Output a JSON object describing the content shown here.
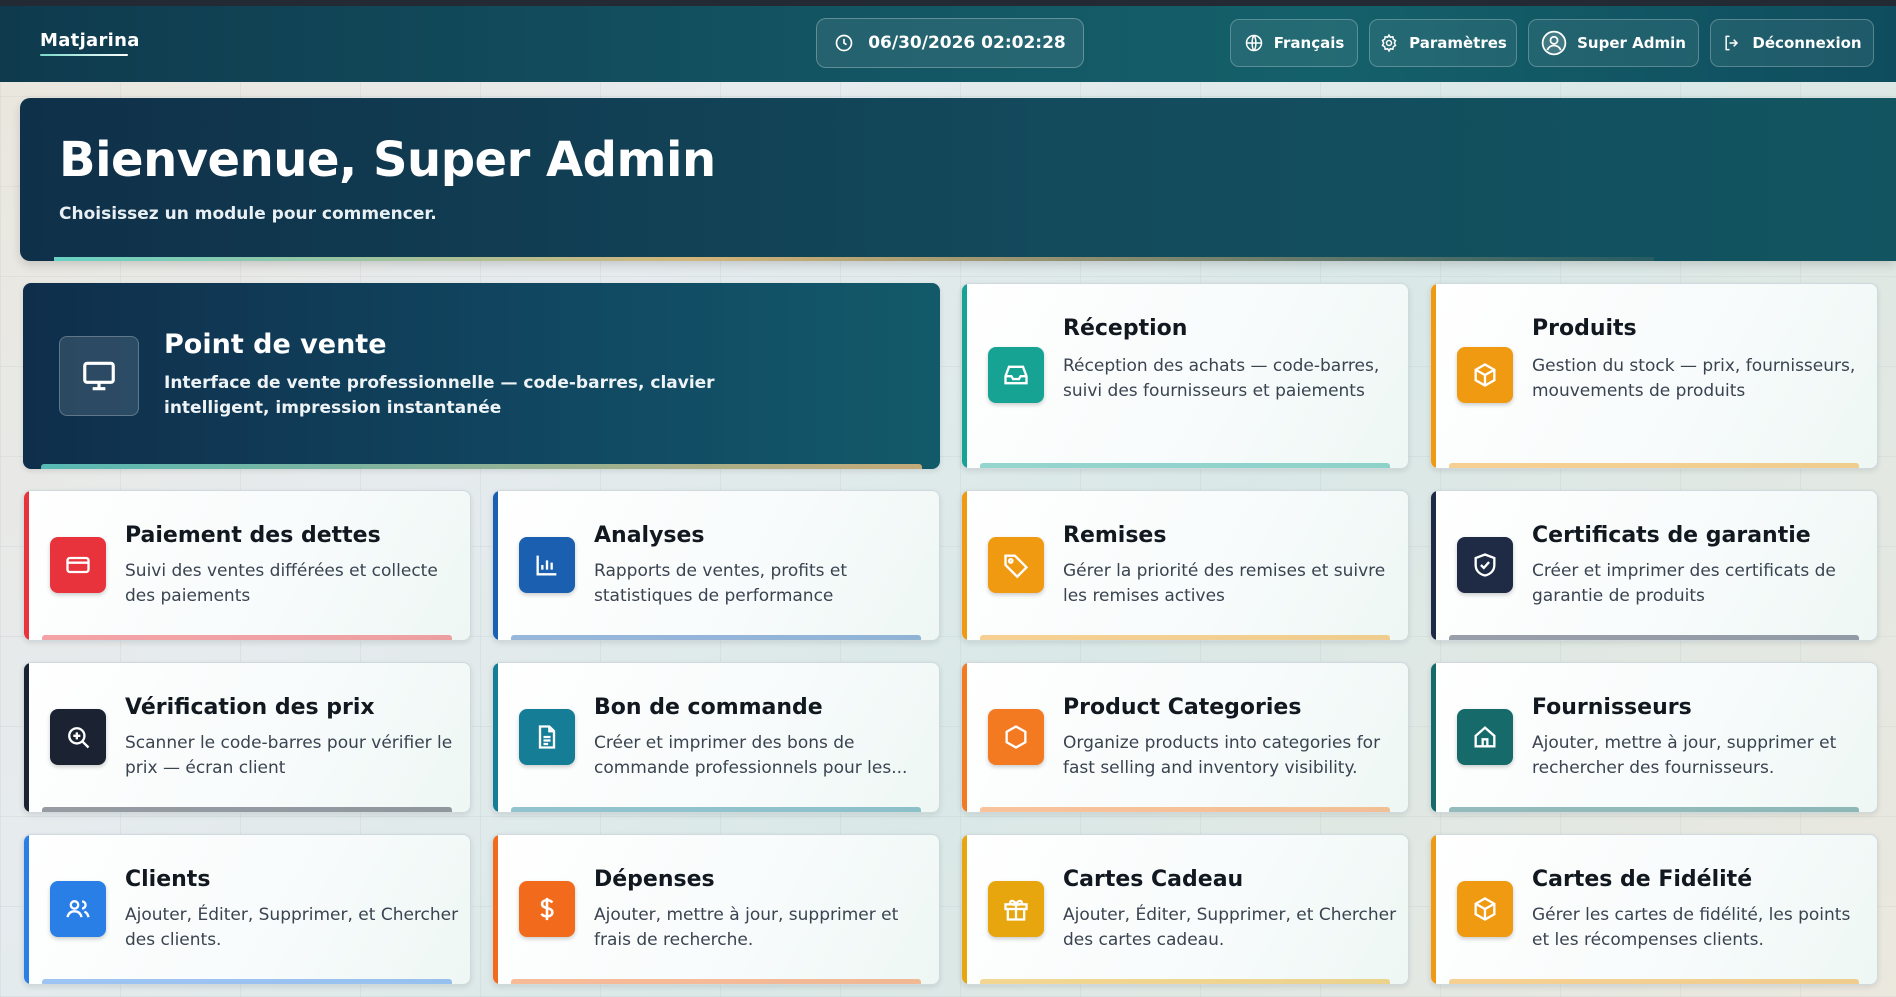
{
  "header": {
    "brand": "Matjarina",
    "clock": "06/30/2026 02:02:28",
    "language": "Français",
    "settings": "Paramètres",
    "user": "Super Admin",
    "logout": "Déconnexion"
  },
  "welcome": {
    "title": "Bienvenue, Super Admin",
    "subtitle": "Choisissez un module pour commencer."
  },
  "modules": [
    {
      "title": "Point de vente",
      "desc": "Interface de vente professionnelle — code-barres, clavier intelligent, impression instantanée",
      "icon": "monitor-icon",
      "color": "#0f3a5a"
    },
    {
      "title": "Réception",
      "desc": "Réception des achats — code-barres, suivi des fournisseurs et paiements",
      "icon": "inbox-icon",
      "color": "#16a394"
    },
    {
      "title": "Produits",
      "desc": "Gestion du stock — prix, fournisseurs, mouvements de produits",
      "icon": "box-icon",
      "color": "#f09a12"
    },
    {
      "title": "Paiement des dettes",
      "desc": "Suivi des ventes différées et collecte des paiements",
      "icon": "card-icon",
      "color": "#e8333c"
    },
    {
      "title": "Analyses",
      "desc": "Rapports de ventes, profits et statistiques de performance",
      "icon": "chart-icon",
      "color": "#1a5fb0"
    },
    {
      "title": "Remises",
      "desc": "Gérer la priorité des remises et suivre les remises actives",
      "icon": "tag-icon",
      "color": "#f09a12"
    },
    {
      "title": "Certificats de garantie",
      "desc": "Créer et imprimer des certificats de garantie de produits",
      "icon": "shield-check-icon",
      "color": "#1f2b44"
    },
    {
      "title": "Vérification des prix",
      "desc": "Scanner le code-barres pour vérifier le prix — écran client",
      "icon": "zoom-icon",
      "color": "#1b2333"
    },
    {
      "title": "Bon de commande",
      "desc": "Créer et imprimer des bons de commande professionnels pour les...",
      "icon": "document-icon",
      "color": "#157d95"
    },
    {
      "title": "Product Categories",
      "desc": "Organize products into categories for fast selling and inventory visibility.",
      "icon": "hexagon-icon",
      "color": "#f47a22"
    },
    {
      "title": "Fournisseurs",
      "desc": "Ajouter, mettre à jour, supprimer et rechercher des fournisseurs.",
      "icon": "home-icon",
      "color": "#166a6a"
    },
    {
      "title": "Clients",
      "desc": "Ajouter, Éditer, Supprimer, et Chercher des clients.",
      "icon": "users-icon",
      "color": "#2a7fe6"
    },
    {
      "title": "Dépenses",
      "desc": "Ajouter, mettre à jour, supprimer et frais de recherche.",
      "icon": "dollar-icon",
      "color": "#f26b1d"
    },
    {
      "title": "Cartes Cadeau",
      "desc": "Ajouter, Éditer, Supprimer, et Chercher des cartes cadeau.",
      "icon": "gift-icon",
      "color": "#e7a60e"
    },
    {
      "title": "Cartes de Fidélité",
      "desc": "Gérer les cartes de fidélité, les points et les récompenses clients.",
      "icon": "box-icon",
      "color": "#f09a12"
    }
  ]
}
